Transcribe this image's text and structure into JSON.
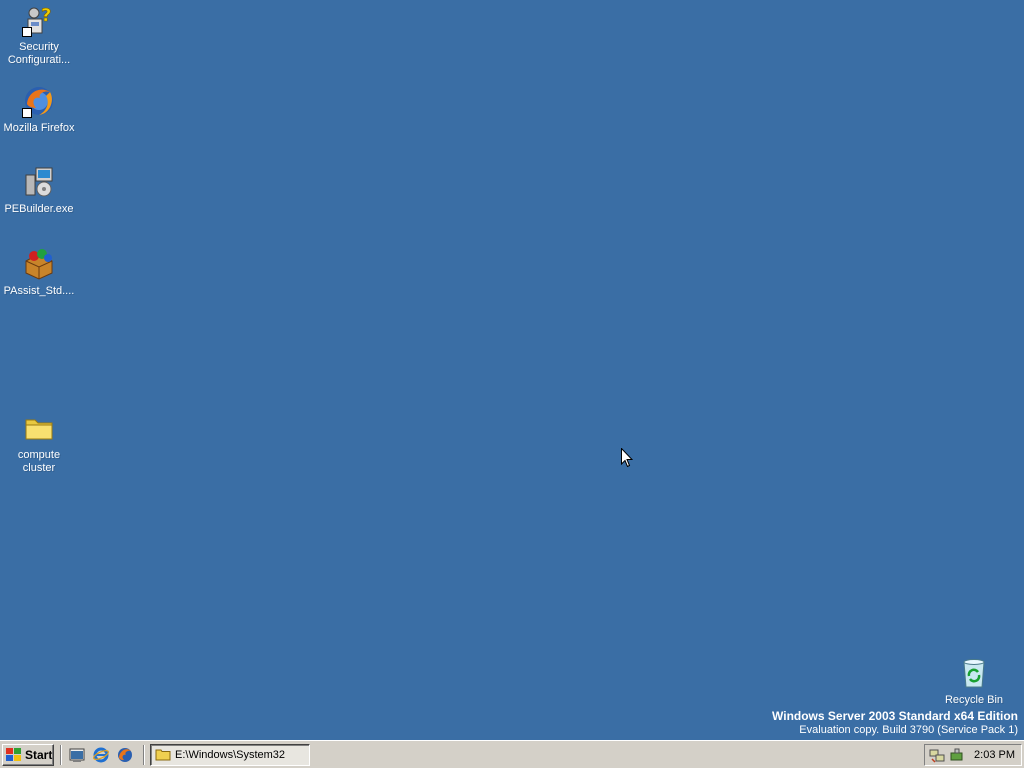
{
  "desktop": {
    "background": "#3a6ea5",
    "icons": [
      {
        "label": "Security\nConfigurati...",
        "icon": "security-configuration-icon"
      },
      {
        "label": "Mozilla Firefox",
        "icon": "firefox-icon"
      },
      {
        "label": "PEBuilder.exe",
        "icon": "pebuilder-icon"
      },
      {
        "label": "PAssist_Std....",
        "icon": "partition-assistant-icon"
      },
      {
        "label": "compute\ncluster",
        "icon": "folder-icon"
      },
      {
        "label": "Recycle Bin",
        "icon": "recycle-bin-icon"
      }
    ],
    "watermark": {
      "title": "Windows Server 2003 Standard x64 Edition",
      "subtitle": "Evaluation copy. Build 3790 (Service Pack 1)"
    }
  },
  "taskbar": {
    "start_label": "Start",
    "quick_launch": [
      "show-desktop-icon",
      "internet-explorer-icon",
      "firefox-icon"
    ],
    "tasks": [
      {
        "label": "E:\\Windows\\System32",
        "icon": "folder-icon"
      }
    ],
    "tray_icons": [
      "network-icon",
      "safely-remove-hardware-icon"
    ],
    "clock": "2:03 PM"
  }
}
